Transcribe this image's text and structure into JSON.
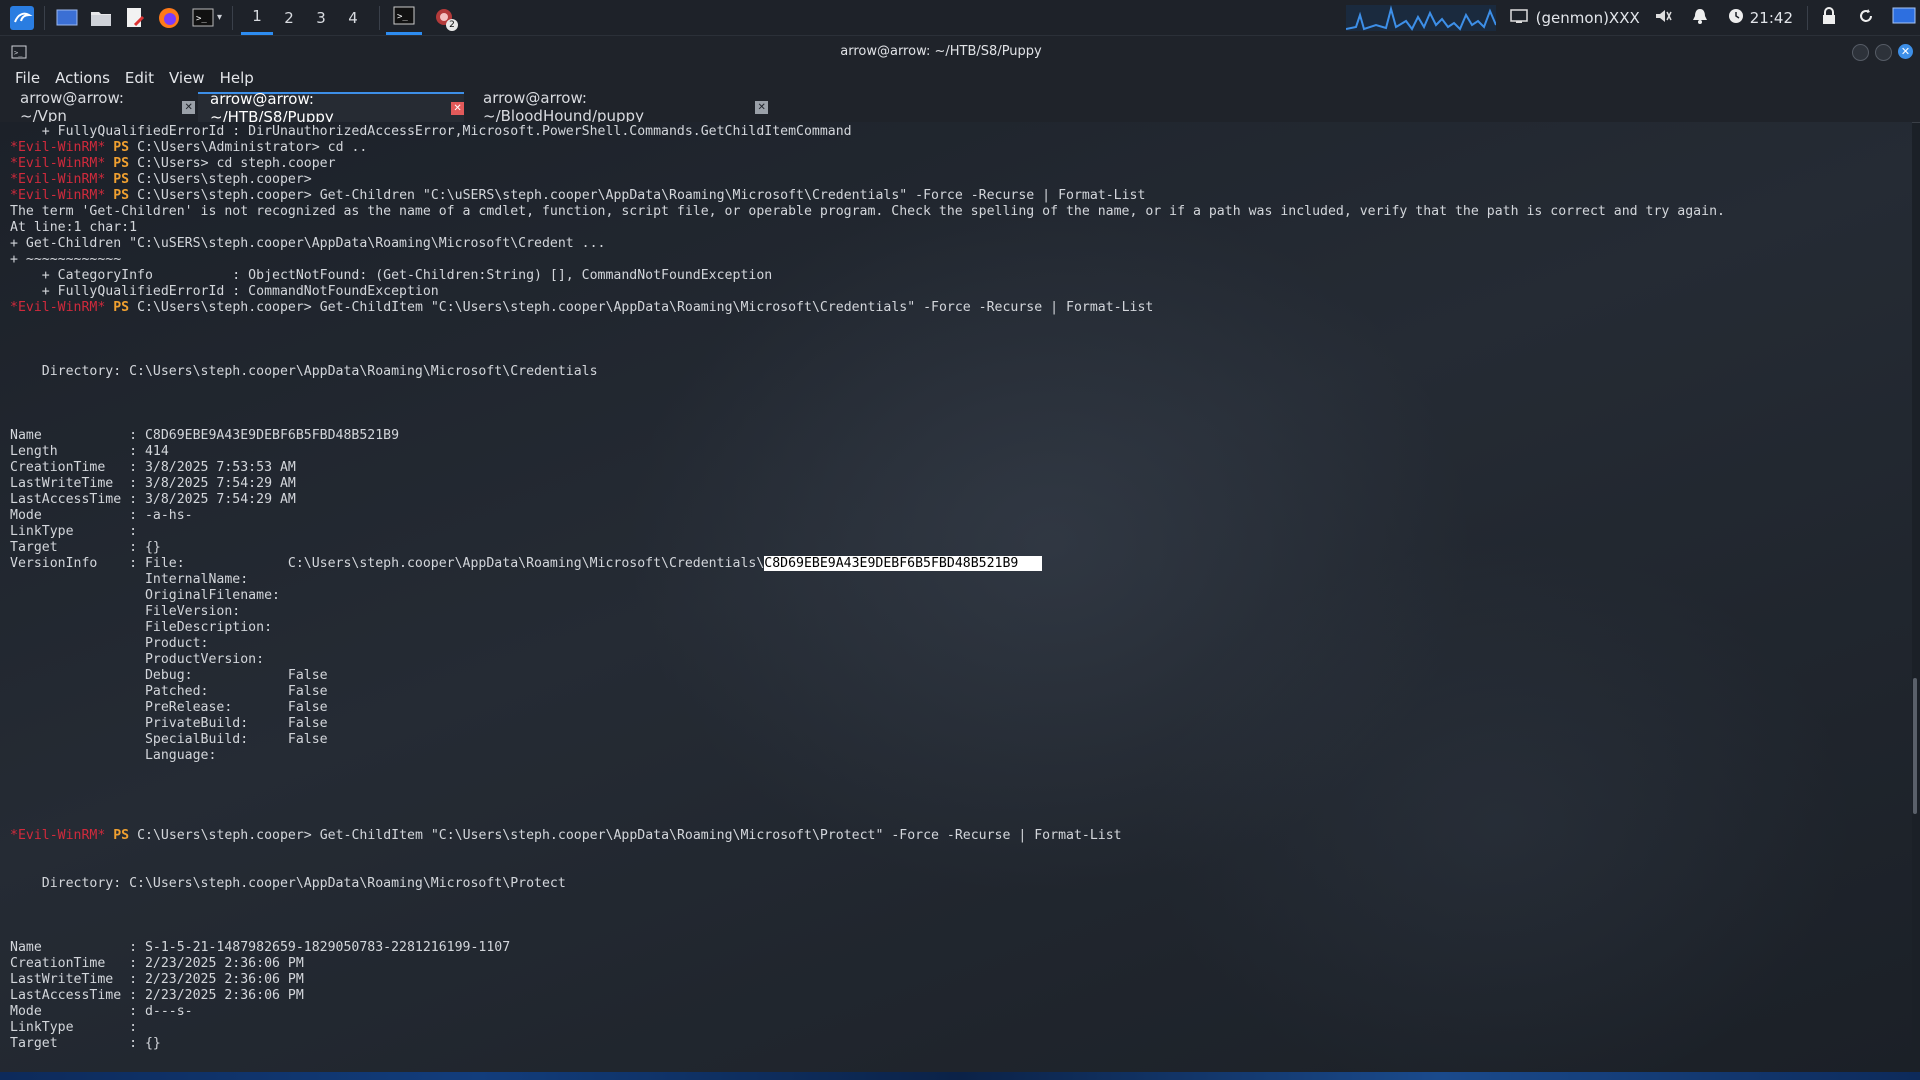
{
  "panel": {
    "workspaces": [
      "1",
      "2",
      "3",
      "4"
    ],
    "genmon": "(genmon)XXX",
    "clock": "21:42",
    "badge": "2",
    "colors": {
      "accent": "#2d8cf0",
      "panel_bg": "#1e2229"
    }
  },
  "window": {
    "title": "arrow@arrow: ~/HTB/S8/Puppy",
    "menu": [
      "File",
      "Actions",
      "Edit",
      "View",
      "Help"
    ],
    "tabs": [
      {
        "label": "arrow@arrow: ~/Vpn",
        "active": false
      },
      {
        "label": "arrow@arrow: ~/HTB/S8/Puppy",
        "active": true
      },
      {
        "label": "arrow@arrow: ~/BloodHound/puppy",
        "active": false
      }
    ]
  },
  "terminal": {
    "prompt_label": "*Evil-WinRM*",
    "ps_label": "PS",
    "highlighted": "C8D69EBE9A43E9DEBF6B5FBD48B521B9",
    "lines": [
      {
        "kind": "text",
        "text": "    + FullyQualifiedErrorId : DirUnauthorizedAccessError,Microsoft.PowerShell.Commands.GetChildItemCommand"
      },
      {
        "kind": "prompt",
        "path": " C:\\Users\\Administrator> ",
        "cmd": "cd .."
      },
      {
        "kind": "prompt",
        "path": " C:\\Users> ",
        "cmd": "cd steph.cooper"
      },
      {
        "kind": "prompt",
        "path": " C:\\Users\\steph.cooper> ",
        "cmd": ""
      },
      {
        "kind": "prompt",
        "path": " C:\\Users\\steph.cooper> ",
        "cmd": "Get-Children \"C:\\uSERS\\steph.cooper\\AppData\\Roaming\\Microsoft\\Credentials\" -Force -Recurse | Format-List"
      },
      {
        "kind": "text",
        "text": "The term 'Get-Children' is not recognized as the name of a cmdlet, function, script file, or operable program. Check the spelling of the name, or if a path was included, verify that the path is correct and try again."
      },
      {
        "kind": "text",
        "text": "At line:1 char:1"
      },
      {
        "kind": "text",
        "text": "+ Get-Children \"C:\\uSERS\\steph.cooper\\AppData\\Roaming\\Microsoft\\Credent ..."
      },
      {
        "kind": "text",
        "text": "+ ~~~~~~~~~~~~"
      },
      {
        "kind": "text",
        "text": "    + CategoryInfo          : ObjectNotFound: (Get-Children:String) [], CommandNotFoundException"
      },
      {
        "kind": "text",
        "text": "    + FullyQualifiedErrorId : CommandNotFoundException"
      },
      {
        "kind": "prompt",
        "path": " C:\\Users\\steph.cooper> ",
        "cmd": "Get-ChildItem \"C:\\Users\\steph.cooper\\AppData\\Roaming\\Microsoft\\Credentials\" -Force -Recurse | Format-List"
      },
      {
        "kind": "blank",
        "text": ""
      },
      {
        "kind": "blank",
        "text": ""
      },
      {
        "kind": "blank",
        "text": ""
      },
      {
        "kind": "text",
        "text": "    Directory: C:\\Users\\steph.cooper\\AppData\\Roaming\\Microsoft\\Credentials"
      },
      {
        "kind": "blank",
        "text": ""
      },
      {
        "kind": "blank",
        "text": ""
      },
      {
        "kind": "blank",
        "text": ""
      },
      {
        "kind": "text",
        "text": "Name           : C8D69EBE9A43E9DEBF6B5FBD48B521B9"
      },
      {
        "kind": "text",
        "text": "Length         : 414"
      },
      {
        "kind": "text",
        "text": "CreationTime   : 3/8/2025 7:53:53 AM"
      },
      {
        "kind": "text",
        "text": "LastWriteTime  : 3/8/2025 7:54:29 AM"
      },
      {
        "kind": "text",
        "text": "LastAccessTime : 3/8/2025 7:54:29 AM"
      },
      {
        "kind": "text",
        "text": "Mode           : -a-hs-"
      },
      {
        "kind": "text",
        "text": "LinkType       :"
      },
      {
        "kind": "text",
        "text": "Target         : {}"
      },
      {
        "kind": "hl",
        "pre": "VersionInfo    : File:             C:\\Users\\steph.cooper\\AppData\\Roaming\\Microsoft\\Credentials\\",
        "post": ""
      },
      {
        "kind": "text",
        "text": "                 InternalName:"
      },
      {
        "kind": "text",
        "text": "                 OriginalFilename:"
      },
      {
        "kind": "text",
        "text": "                 FileVersion:"
      },
      {
        "kind": "text",
        "text": "                 FileDescription:"
      },
      {
        "kind": "text",
        "text": "                 Product:"
      },
      {
        "kind": "text",
        "text": "                 ProductVersion:"
      },
      {
        "kind": "text",
        "text": "                 Debug:            False"
      },
      {
        "kind": "text",
        "text": "                 Patched:          False"
      },
      {
        "kind": "text",
        "text": "                 PreRelease:       False"
      },
      {
        "kind": "text",
        "text": "                 PrivateBuild:     False"
      },
      {
        "kind": "text",
        "text": "                 SpecialBuild:     False"
      },
      {
        "kind": "text",
        "text": "                 Language:"
      },
      {
        "kind": "blank",
        "text": ""
      },
      {
        "kind": "blank",
        "text": ""
      },
      {
        "kind": "blank",
        "text": ""
      },
      {
        "kind": "blank",
        "text": ""
      },
      {
        "kind": "prompt",
        "path": " C:\\Users\\steph.cooper> ",
        "cmd": "Get-ChildItem \"C:\\Users\\steph.cooper\\AppData\\Roaming\\Microsoft\\Protect\" -Force -Recurse | Format-List"
      },
      {
        "kind": "blank",
        "text": ""
      },
      {
        "kind": "blank",
        "text": ""
      },
      {
        "kind": "text",
        "text": "    Directory: C:\\Users\\steph.cooper\\AppData\\Roaming\\Microsoft\\Protect"
      },
      {
        "kind": "blank",
        "text": ""
      },
      {
        "kind": "blank",
        "text": ""
      },
      {
        "kind": "blank",
        "text": ""
      },
      {
        "kind": "text",
        "text": "Name           : S-1-5-21-1487982659-1829050783-2281216199-1107"
      },
      {
        "kind": "text",
        "text": "CreationTime   : 2/23/2025 2:36:06 PM"
      },
      {
        "kind": "text",
        "text": "LastWriteTime  : 2/23/2025 2:36:06 PM"
      },
      {
        "kind": "text",
        "text": "LastAccessTime : 2/23/2025 2:36:06 PM"
      },
      {
        "kind": "text",
        "text": "Mode           : d---s-"
      },
      {
        "kind": "text",
        "text": "LinkType       :"
      },
      {
        "kind": "text",
        "text": "Target         : {}"
      }
    ]
  }
}
